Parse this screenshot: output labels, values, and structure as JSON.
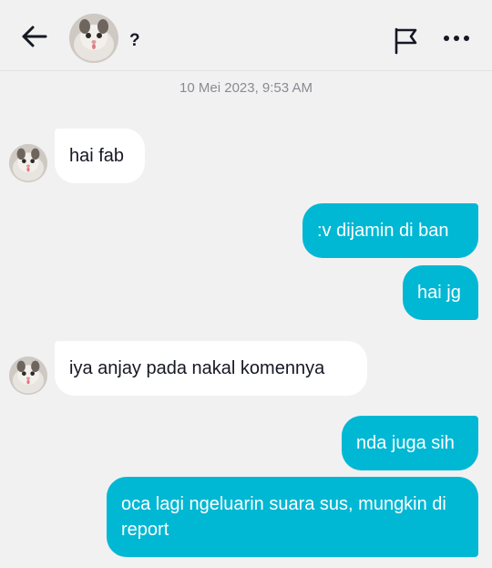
{
  "header": {
    "contact_name": "?",
    "icons": {
      "back": "back-arrow-icon",
      "report": "flag-icon",
      "more": "more-dots-icon"
    }
  },
  "timestamp": "10 Mei 2023, 9:53 AM",
  "messages": [
    {
      "direction": "in",
      "text": "hai fab"
    },
    {
      "direction": "out",
      "text": ":v dijamin di ban"
    },
    {
      "direction": "out",
      "text": "hai jg"
    },
    {
      "direction": "in",
      "text": "iya anjay pada nakal komennya"
    },
    {
      "direction": "out",
      "text": "nda juga sih"
    },
    {
      "direction": "out",
      "text": "oca lagi ngeluarin suara sus, mungkin di report"
    }
  ],
  "colors": {
    "background": "#f1f1f2",
    "outgoing_bubble": "#00b8d4",
    "incoming_bubble": "#ffffff",
    "timestamp_text": "#8a8b91"
  }
}
